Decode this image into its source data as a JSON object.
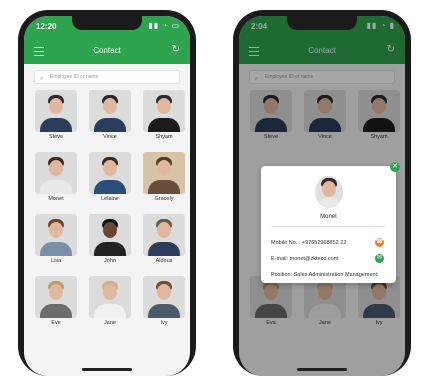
{
  "left": {
    "time": "12:20",
    "header_title": "Contact",
    "search_placeholder": "Employee ID or name",
    "contacts": [
      {
        "name": "Steve"
      },
      {
        "name": "Vince"
      },
      {
        "name": "Shyam"
      },
      {
        "name": "Monet"
      },
      {
        "name": "Lelaine"
      },
      {
        "name": "Gracely"
      },
      {
        "name": "Lisa"
      },
      {
        "name": "John"
      },
      {
        "name": "Aldous"
      },
      {
        "name": "Eve"
      },
      {
        "name": "Jane"
      },
      {
        "name": "Ivy"
      }
    ]
  },
  "right": {
    "time": "2:04",
    "header_title": "Contact",
    "search_placeholder": "Employee ID or name",
    "contacts": [
      {
        "name": "Steve"
      },
      {
        "name": "Vince"
      },
      {
        "name": "Shyam"
      },
      {
        "name": ""
      },
      {
        "name": ""
      },
      {
        "name": ""
      },
      {
        "name": ""
      },
      {
        "name": ""
      },
      {
        "name": ""
      },
      {
        "name": "Eva"
      },
      {
        "name": "Jane"
      },
      {
        "name": "Ivy"
      }
    ],
    "popup": {
      "name": "Monet",
      "mobile_label": "Mobile No. : +97652968852 22",
      "email_label": "E-mail: monet@zkteco.com",
      "position_label": "Position: Sales Administration Management"
    }
  },
  "colors": {
    "accent": "#2ea44f",
    "call": "#f07a2c",
    "email": "#2ea44f"
  }
}
